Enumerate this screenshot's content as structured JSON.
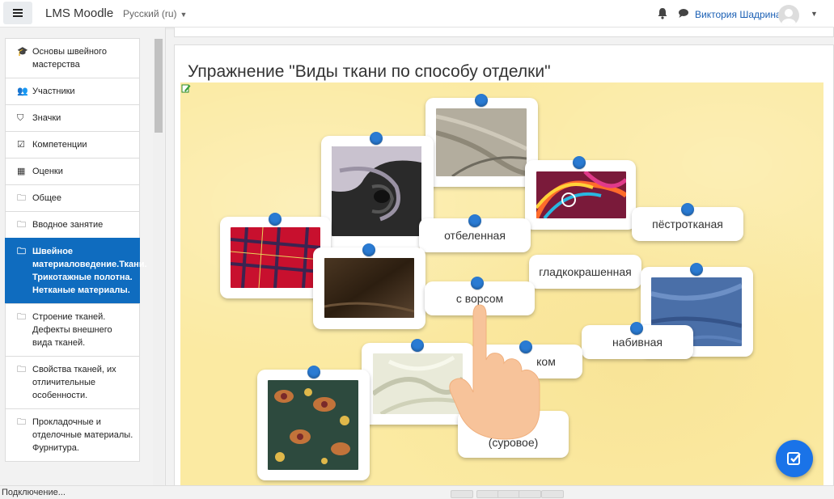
{
  "navbar": {
    "brand": "LMS Moodle",
    "language": "Русский (ru)",
    "user_name": "Виктория Шадрина"
  },
  "drawer": {
    "items": [
      {
        "icon": "graduation-cap-icon",
        "label": "Основы швейного мастерства",
        "active": false
      },
      {
        "icon": "users-icon",
        "label": "Участники",
        "active": false
      },
      {
        "icon": "shield-icon",
        "label": "Значки",
        "active": false
      },
      {
        "icon": "checkbox-icon",
        "label": "Компетенции",
        "active": false
      },
      {
        "icon": "table-icon",
        "label": "Оценки",
        "active": false
      },
      {
        "icon": "folder-icon",
        "label": "Общее",
        "active": false
      },
      {
        "icon": "folder-icon",
        "label": "Вводное занятие",
        "active": false
      },
      {
        "icon": "folder-icon",
        "label": "Швейное материаловедение.Ткани. Трикотажные полотна. Нетканые материалы.",
        "active": true
      },
      {
        "icon": "folder-icon",
        "label": "Строение тканей. Дефекты внешнего вида тканей.",
        "active": false
      },
      {
        "icon": "folder-icon",
        "label": "Свойства тканей, их отличительные особенности.",
        "active": false
      },
      {
        "icon": "folder-icon",
        "label": "Прокладочные и отделочные материалы. Фурнитура.",
        "active": false
      }
    ]
  },
  "exercise": {
    "title": "Упражнение \"Виды ткани по способу отделки\"",
    "labels": {
      "otbelennaya": "отбеленная",
      "pestrotkanaya": "пёстротканая",
      "gladkokrashennaya": "гладкокрашенная",
      "s_vorsom": "с ворсом",
      "nabivnaya": "набивная",
      "partial_kom": "ком",
      "partial_surovaya": "(суровое)"
    },
    "fabrics": [
      {
        "name": "beige-linen"
      },
      {
        "name": "black-silk"
      },
      {
        "name": "colorful-swirl"
      },
      {
        "name": "red-tartan"
      },
      {
        "name": "brown-velvet"
      },
      {
        "name": "blue-denim"
      },
      {
        "name": "white-gauze"
      },
      {
        "name": "paisley-print"
      }
    ]
  },
  "fab": {
    "icon": "check-square-icon"
  },
  "status": {
    "text": "Подключение..."
  },
  "colors": {
    "accent": "#0f6cbf",
    "stage_bg": "#fbeaa2",
    "pin": "#2a7bd3",
    "fab": "#1a73e8"
  }
}
